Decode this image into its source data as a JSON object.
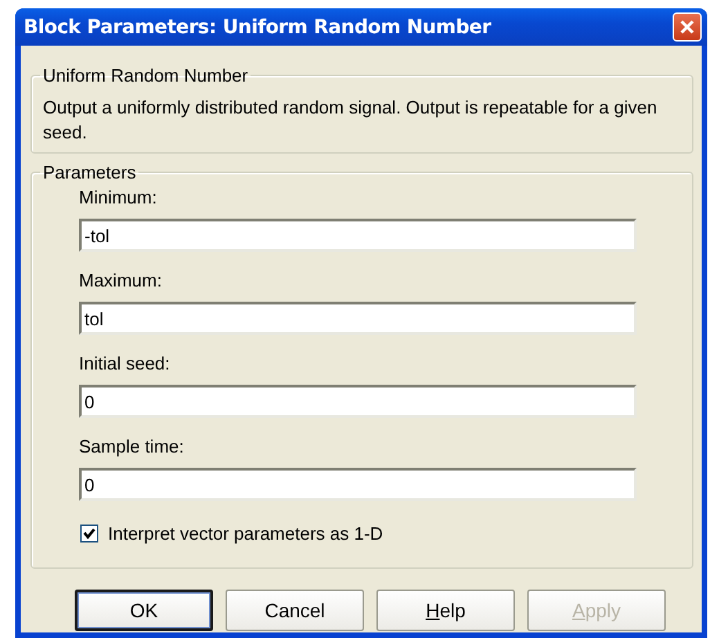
{
  "window": {
    "title": "Block Parameters: Uniform Random Number"
  },
  "block_group": {
    "title": "Uniform Random Number",
    "description": "Output a uniformly distributed random signal.  Output is repeatable for a given seed."
  },
  "parameters_group": {
    "title": "Parameters",
    "fields": [
      {
        "label": "Minimum:",
        "value": "-tol"
      },
      {
        "label": "Maximum:",
        "value": "tol"
      },
      {
        "label": "Initial seed:",
        "value": "0"
      },
      {
        "label": "Sample time:",
        "value": "0"
      }
    ],
    "checkbox": {
      "label": "Interpret vector parameters as 1-D",
      "checked": true
    }
  },
  "buttons": [
    {
      "label": "OK",
      "default": true,
      "disabled": false,
      "underline_first": false
    },
    {
      "label": "Cancel",
      "default": false,
      "disabled": false,
      "underline_first": false
    },
    {
      "label": "Help",
      "default": false,
      "disabled": false,
      "underline_first": true
    },
    {
      "label": "Apply",
      "default": false,
      "disabled": true,
      "underline_first": true
    }
  ]
}
